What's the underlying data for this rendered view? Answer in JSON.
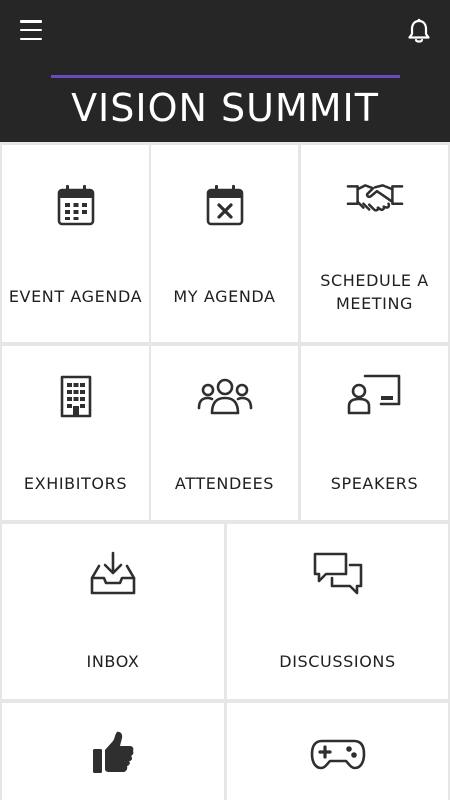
{
  "header": {
    "brand": "VISION SUMMIT",
    "menu_icon": "hamburger-menu-icon",
    "notification_icon": "bell-icon",
    "accent_color": "#6a4bbf",
    "background_color": "#262626"
  },
  "tiles": [
    {
      "label": "EVENT AGENDA",
      "icon": "calendar-icon"
    },
    {
      "label": "MY AGENDA",
      "icon": "calendar-x-icon"
    },
    {
      "label": "SCHEDULE A MEETING",
      "label_line1": "SCHEDULE A",
      "label_line2": "MEETING",
      "icon": "handshake-icon"
    },
    {
      "label": "EXHIBITORS",
      "icon": "building-icon"
    },
    {
      "label": "ATTENDEES",
      "icon": "people-group-icon"
    },
    {
      "label": "SPEAKERS",
      "icon": "presenter-icon"
    },
    {
      "label": "INBOX",
      "icon": "inbox-download-icon"
    },
    {
      "label": "DISCUSSIONS",
      "icon": "chat-bubbles-icon"
    },
    {
      "label": "",
      "icon": "thumbs-up-icon"
    },
    {
      "label": "",
      "icon": "gamepad-icon"
    }
  ]
}
